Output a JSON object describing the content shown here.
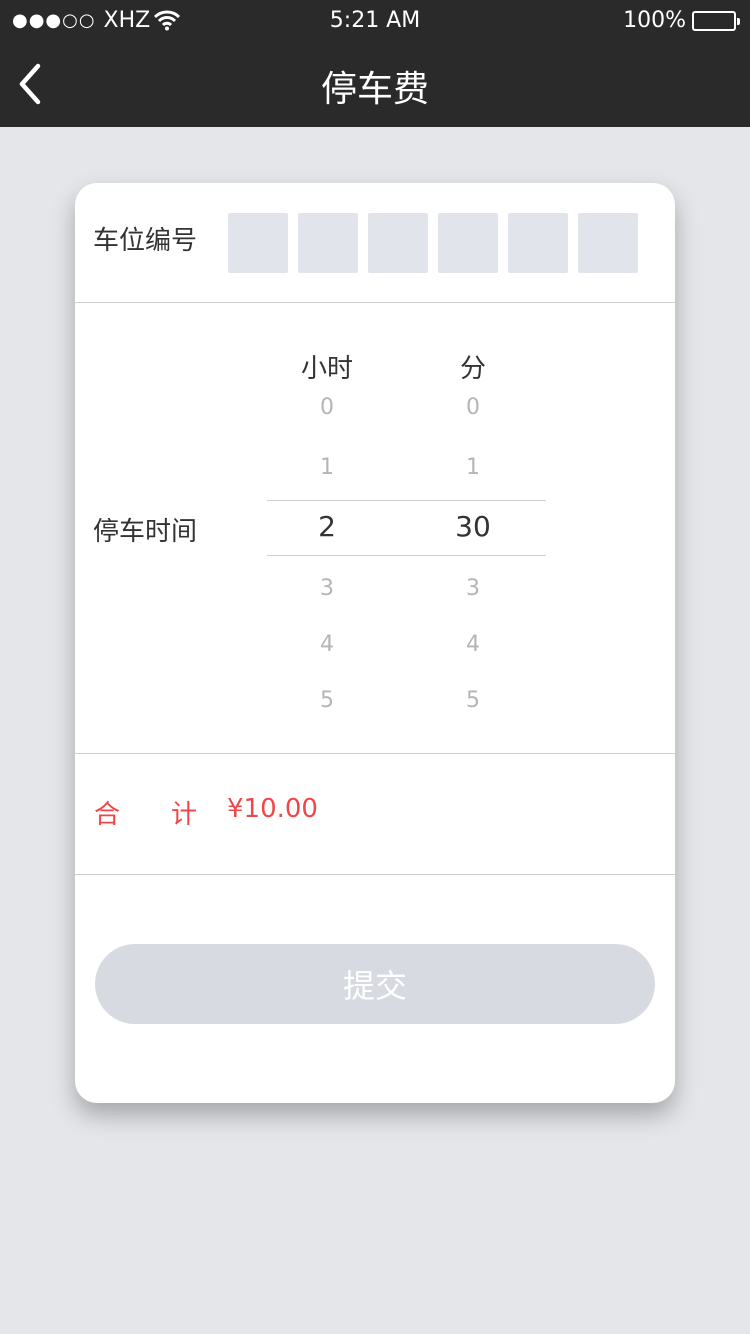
{
  "status_bar": {
    "signal_dots": "●●●○○",
    "carrier": "XHZ",
    "time": "5:21 AM",
    "battery_percent": "100%",
    "battery_level": 1.0
  },
  "nav": {
    "back_icon": "chevron-left-icon",
    "title": "停车费"
  },
  "colors": {
    "nav_bg": "#2a2a2a",
    "page_bg": "#e4e6ea",
    "total_red": "#f0474a",
    "button_disabled": "#d7dae1",
    "code_box": "#e1e4ea"
  },
  "spot_number": {
    "label": "车位编号",
    "boxes": [
      "",
      "",
      "",
      "",
      "",
      ""
    ]
  },
  "parking_time": {
    "label": "停车时间",
    "hour_header": "小时",
    "minute_header": "分",
    "hours": [
      "0",
      "1",
      "2",
      "3",
      "4",
      "5"
    ],
    "minutes": [
      "0",
      "1",
      "30",
      "3",
      "4",
      "5"
    ],
    "selected_hour": "2",
    "selected_minute": "30"
  },
  "total": {
    "label_1": "合",
    "label_2": "计",
    "amount": "¥10.00"
  },
  "submit": {
    "label": "提交"
  }
}
